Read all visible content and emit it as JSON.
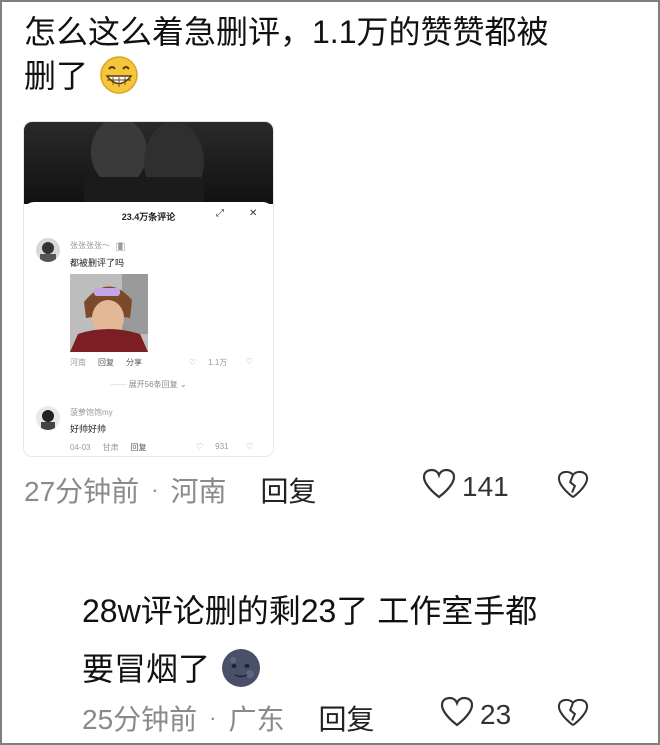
{
  "comment1": {
    "text_line1": "怎么这么着急删评，1.1万的赞赞都被",
    "text_line2": "删了",
    "emoji": "grinning-face",
    "time": "27分钟前",
    "location": "河南",
    "reply": "回复",
    "likes": "141"
  },
  "embedded_screenshot": {
    "title": "23.4万条评论",
    "comment_a": {
      "username": "张张张张～",
      "badge": "█",
      "text": "都被删评了吗",
      "location": "河南",
      "reply": "回复",
      "share": "分享",
      "likes": "1.1万"
    },
    "expand": "展开56条回复",
    "comment_b": {
      "username": "菠萝饱饱my",
      "text": "好帅好帅",
      "date": "04-03",
      "location": "甘肃",
      "reply": "回复",
      "likes": "931"
    }
  },
  "comment2": {
    "text_line1": "28w评论删的剩23了 工作室手都",
    "text_line2": "要冒烟了",
    "emoji": "new-moon-face",
    "time": "25分钟前",
    "location": "广东",
    "reply": "回复",
    "likes": "23"
  },
  "colors": {
    "border": "#7f7f7f",
    "meta_gray": "#8a8a8a",
    "emoji_yellow": "#f6c63a",
    "moon": "#4a5068"
  }
}
